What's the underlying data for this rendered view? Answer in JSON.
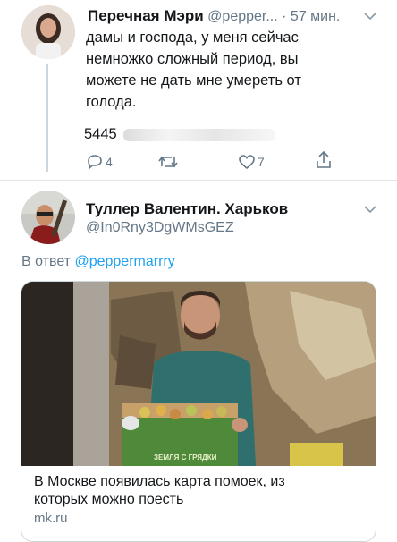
{
  "tweet": {
    "name": "Перечная Мэри",
    "handle": "@pepper...",
    "time": "· 57 мин.",
    "text_lines": [
      "дамы и господа, у меня сейчас",
      "немножко сложный период, вы",
      "можете не дать мне умереть от",
      "голода."
    ],
    "card_number_partial": "5445",
    "reply_count": "4",
    "like_count": "7"
  },
  "reply": {
    "name": "Туллер Валентин. Харьков",
    "handle": "@In0Rny3DgWMsGEZ",
    "reply_prefix": "В ответ",
    "reply_to": "@peppermarrry",
    "card": {
      "title_lines": [
        "В Москве появилась карта помоек, из",
        "которых можно поесть"
      ],
      "domain": "mk.ru",
      "box_label": "ЗЕМЛЯ С ГРЯДКИ"
    }
  },
  "colors": {
    "accent": "#1da1f2",
    "muted": "#657786"
  }
}
